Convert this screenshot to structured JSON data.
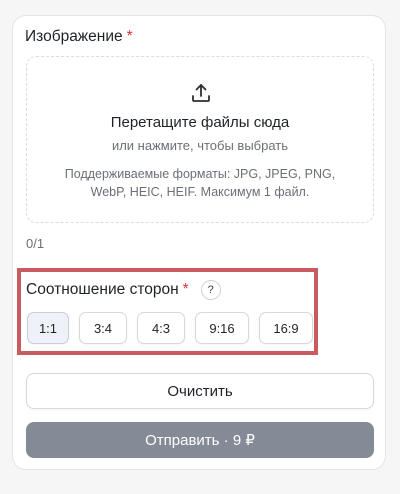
{
  "image_field": {
    "label": "Изображение",
    "required_mark": "*",
    "drop_title": "Перетащите файлы сюда",
    "drop_subtitle": "или нажмите, чтобы выбрать",
    "formats": "Поддерживаемые форматы: JPG, JPEG, PNG, WebP, HEIC, HEIF. Максимум 1 файл.",
    "counter": "0/1",
    "icon": "upload-icon"
  },
  "aspect": {
    "label": "Соотношение сторон",
    "required_mark": "*",
    "help": "?",
    "options": [
      "1:1",
      "3:4",
      "4:3",
      "9:16",
      "16:9"
    ],
    "selected": "1:1"
  },
  "actions": {
    "clear_label": "Очистить",
    "submit_label": "Отправить · 9 ₽"
  },
  "colors": {
    "accent_highlight": "#c85a60",
    "required": "#d9363e",
    "submit_bg": "#848b96"
  }
}
